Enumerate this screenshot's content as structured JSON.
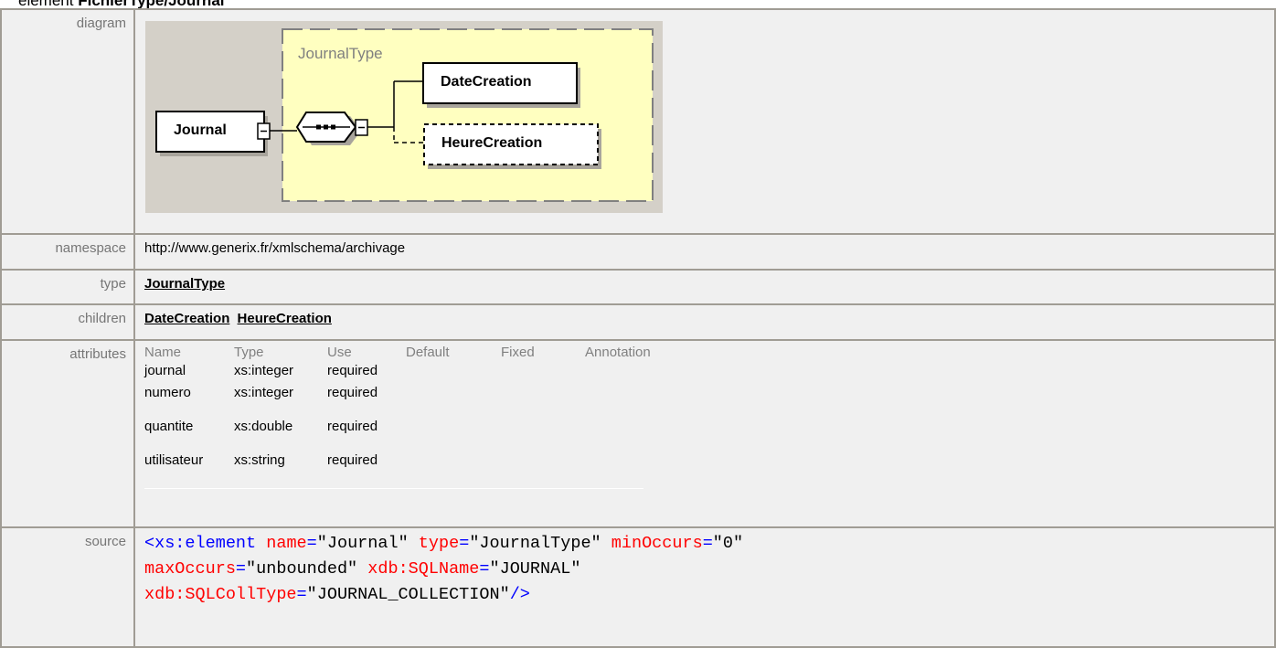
{
  "heading": {
    "prefix": "element",
    "name": "FichierType/Journal"
  },
  "labels": {
    "diagram": "diagram",
    "namespace": "namespace",
    "type": "type",
    "children": "children",
    "attributes": "attributes",
    "source": "source"
  },
  "diagram": {
    "type_name": "JournalType",
    "element": "Journal",
    "child1": "DateCreation",
    "child2": "HeureCreation"
  },
  "namespace": "http://www.generix.fr/xmlschema/archivage",
  "type": "JournalType",
  "children": [
    "DateCreation",
    "HeureCreation"
  ],
  "attributes": {
    "headers": [
      "Name",
      "Type",
      "Use",
      "Default",
      "Fixed",
      "Annotation"
    ],
    "rows": [
      [
        "journal",
        "xs:integer",
        "required"
      ],
      [
        "numero",
        "xs:integer",
        "required"
      ],
      [
        "quantite",
        "xs:double",
        "required"
      ],
      [
        "utilisateur",
        "xs:string",
        "required"
      ]
    ]
  },
  "source": {
    "open": "<xs:element",
    "name_attr": "name",
    "name_val": "\"Journal\"",
    "type_attr": "type",
    "type_val": "\"JournalType\"",
    "min_attr": "minOccurs",
    "min_val": "\"0\"",
    "max_attr": "maxOccurs",
    "max_val": "\"unbounded\"",
    "sqlname_attr": "xdb:SQLName",
    "sqlname_val": "\"JOURNAL\"",
    "colltype_attr": "xdb:SQLCollType",
    "colltype_val": "\"JOURNAL_COLLECTION\"",
    "close": "/>",
    "eq": "="
  },
  "colors": {
    "tag": "#0000ff",
    "attr": "#ff0000",
    "border": "#a09c94",
    "cell": "#f0f0f0",
    "diagram_bg": "#d4d0c8",
    "type_box": "#ffffc0"
  }
}
